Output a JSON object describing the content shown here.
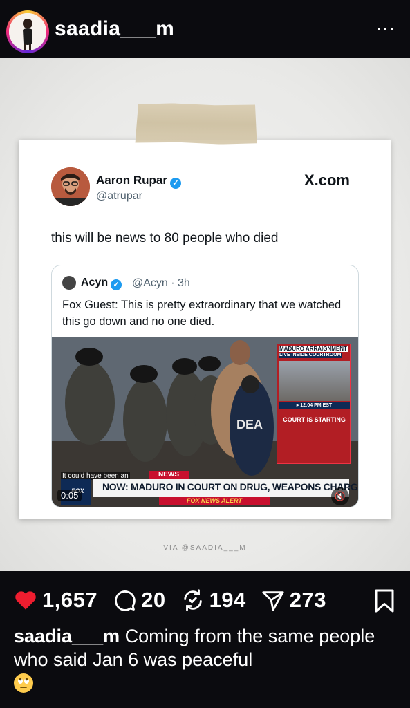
{
  "header": {
    "username": "saadia___m",
    "more_icon": "more-horizontal-icon",
    "more_label": "···"
  },
  "post": {
    "tweet": {
      "author_name": "Aaron Rupar",
      "author_handle": "@atrupar",
      "source": "X.com",
      "text": "this will be news to 80 people who died",
      "quote": {
        "author_name": "Acyn",
        "meta": "@Acyn · 3h",
        "text": "Fox Guest: This is pretty extraordinary that we watched this go down and no one died.",
        "video": {
          "inset_title": "MADURO ARRAIGNMENT",
          "inset_subtitle": "LIVE INSIDE COURTROOM",
          "inset_time": "▸ 12:04 PM EST",
          "inset_status": "COURT IS STARTING",
          "closed_caption": "It could have been an",
          "breaking_label": "NEWS",
          "headline": "NOW: MADURO IN COURT ON DRUG, WEAPONS CHARGES",
          "alert": "FOX NEWS ALERT",
          "network": "FOX",
          "timer": "0:05",
          "vest_label": "DEA"
        }
      }
    },
    "via": "VIA @SAADIA___M"
  },
  "actions": {
    "likes": "1,657",
    "comments": "20",
    "reposts": "194",
    "shares": "273"
  },
  "caption": {
    "username": "saadia___m",
    "text": "Coming from the same people who said Jan 6 was peaceful"
  },
  "colors": {
    "like": "#ee1d2f",
    "verified": "#1d9bf0",
    "fox_red": "#c8102e"
  }
}
